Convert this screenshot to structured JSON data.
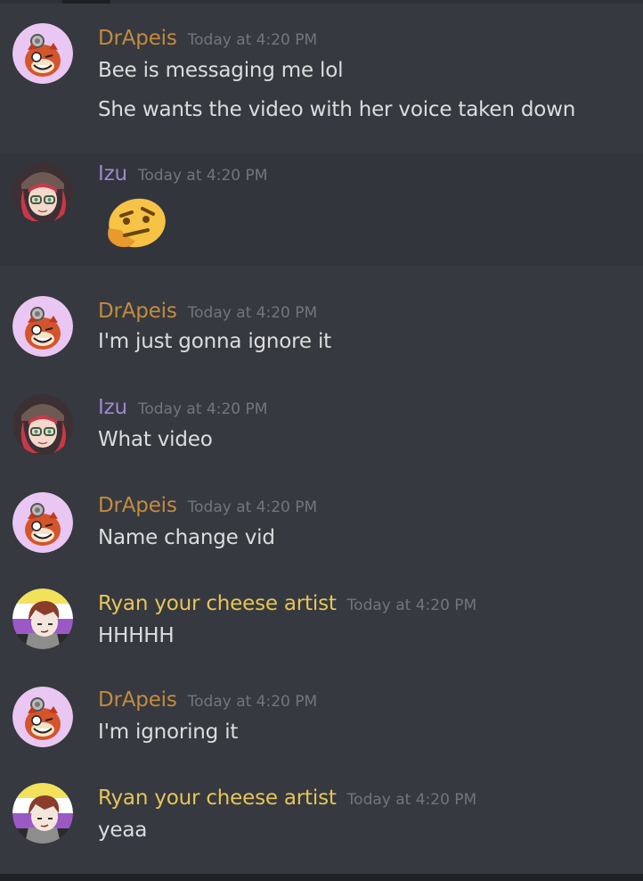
{
  "messages": [
    {
      "author": "DrApeis",
      "time": "Today at 4:20 PM",
      "lines": [
        "Bee is messaging me lol",
        "She wants the video with her voice taken down"
      ]
    },
    {
      "author": "Izu",
      "time": "Today at 4:20 PM",
      "emoji": "thinking-emoji"
    },
    {
      "author": "DrApeis",
      "time": "Today at 4:20 PM",
      "lines": [
        "I'm just gonna ignore it"
      ]
    },
    {
      "author": "Izu",
      "time": "Today at 4:20 PM",
      "lines": [
        "What video"
      ]
    },
    {
      "author": "DrApeis",
      "time": "Today at 4:20 PM",
      "lines": [
        "Name change vid"
      ]
    },
    {
      "author": "Ryan your cheese artist",
      "time": "Today at 4:20 PM",
      "lines": [
        "HHHHH"
      ]
    },
    {
      "author": "DrApeis",
      "time": "Today at 4:20 PM",
      "lines": [
        "I'm ignoring it"
      ]
    },
    {
      "author": "Ryan your cheese artist",
      "time": "Today at 4:20 PM",
      "lines": [
        "yeaa"
      ]
    }
  ],
  "colors": {
    "background": "#36393f",
    "highlight": "#32353b",
    "text": "#dcddde",
    "timestamp": "#72767d",
    "drapeis": "#c48b3f",
    "izu": "#a086d0",
    "ryan": "#e6c55a"
  }
}
